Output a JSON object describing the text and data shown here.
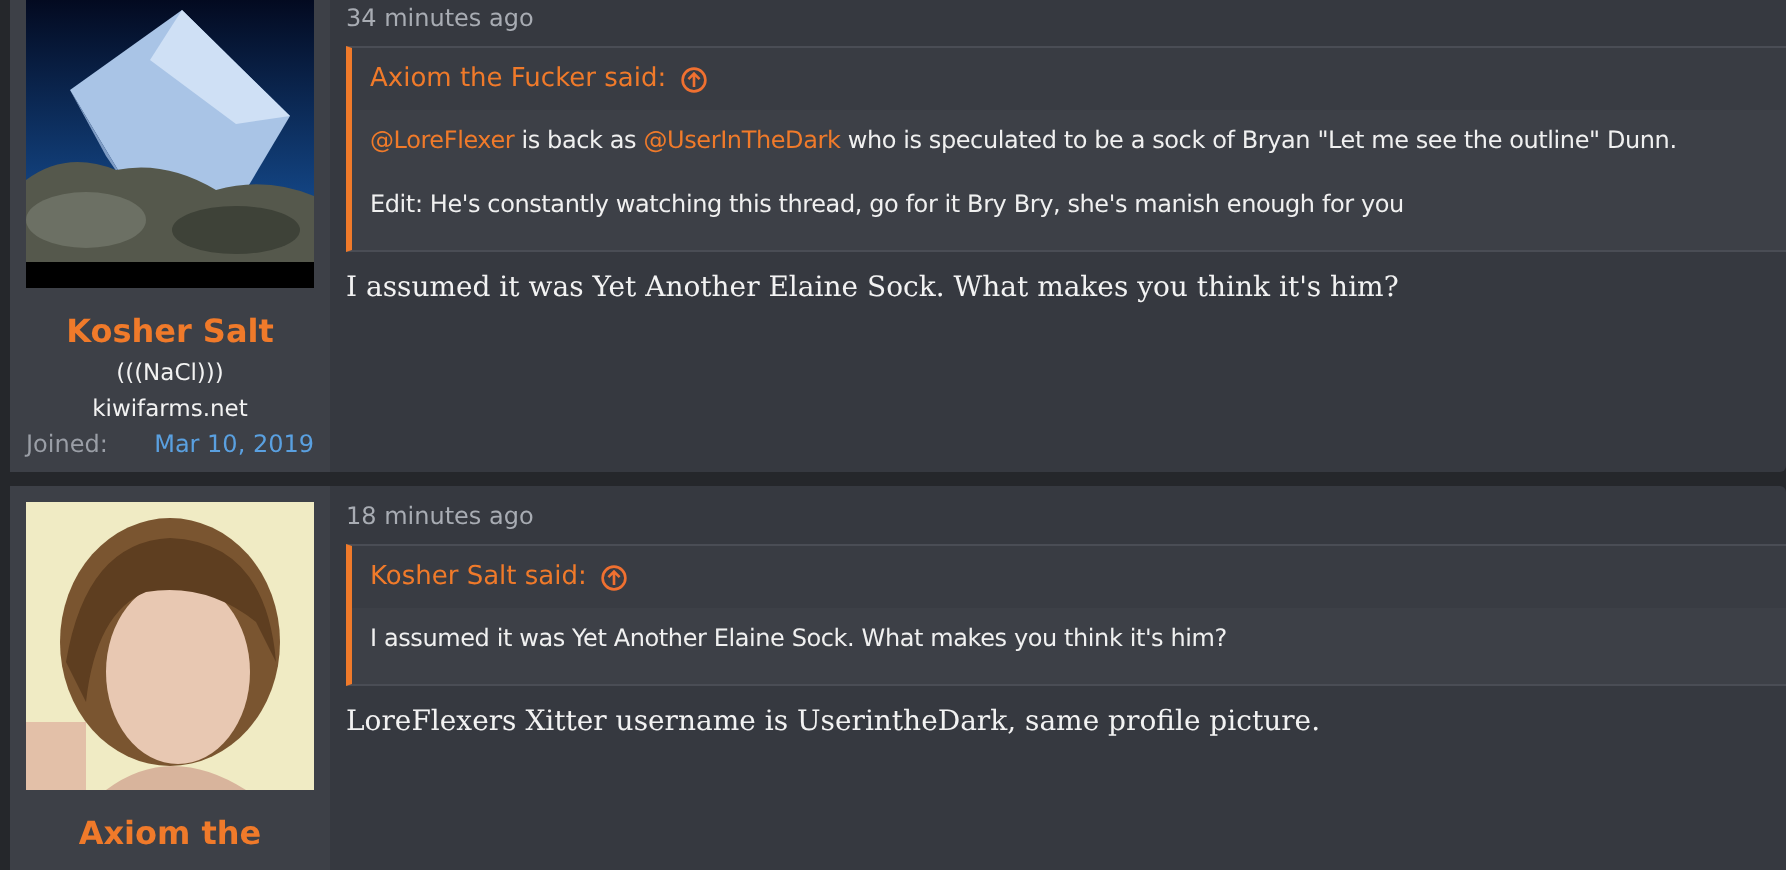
{
  "posts": [
    {
      "author": {
        "name": "Kosher Salt",
        "title": "(((NaCl)))",
        "site": "kiwifarms.net",
        "joined_label": "Joined:",
        "joined_date": "Mar 10, 2019"
      },
      "time": "34 minutes ago",
      "quote": {
        "attribution": "Axiom the Fucker said:",
        "paragraphs": [
          [
            {
              "kind": "mention",
              "text": "@LoreFlexer"
            },
            {
              "kind": "text",
              "text": " is back as "
            },
            {
              "kind": "mention",
              "text": "@UserInTheDark"
            },
            {
              "kind": "text",
              "text": " who is speculated to be a sock of Bryan \"Let me see the outline\" Dunn."
            }
          ],
          [
            {
              "kind": "text",
              "text": "Edit: He's constantly watching this thread, go for it Bry Bry, she's manish enough for you"
            }
          ]
        ]
      },
      "message": "I assumed it was Yet Another Elaine Sock. What makes you think it's him?"
    },
    {
      "author": {
        "name": "Axiom the"
      },
      "time": "18 minutes ago",
      "quote": {
        "attribution": "Kosher Salt said:",
        "paragraphs": [
          [
            {
              "kind": "text",
              "text": "I assumed it was Yet Another Elaine Sock. What makes you think it's him?"
            }
          ]
        ]
      },
      "message": "LoreFlexers Xitter username is UserintheDark, same profile picture."
    }
  ]
}
